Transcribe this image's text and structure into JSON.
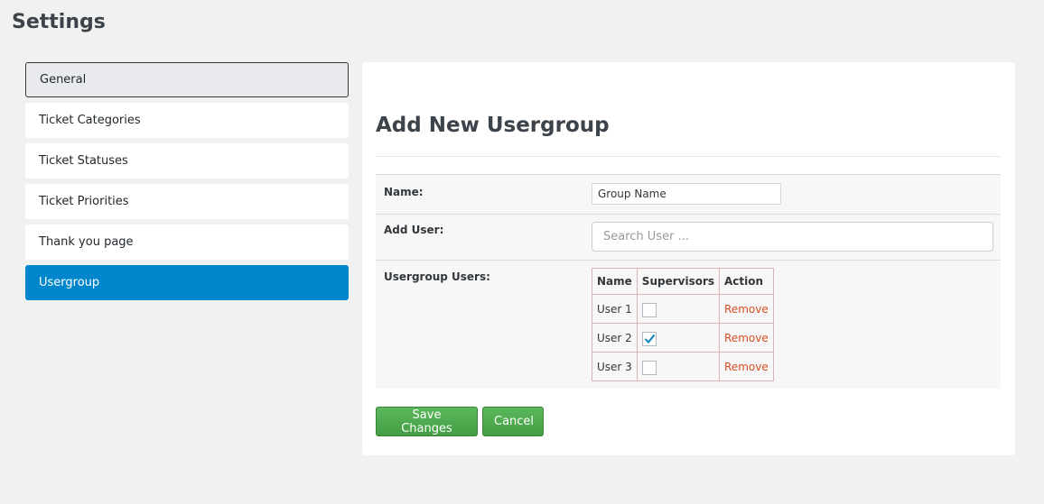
{
  "page": {
    "title": "Settings"
  },
  "sidebar": {
    "items": [
      {
        "label": "General"
      },
      {
        "label": "Ticket Categories"
      },
      {
        "label": "Ticket Statuses"
      },
      {
        "label": "Ticket Priorities"
      },
      {
        "label": "Thank you page"
      },
      {
        "label": "Usergroup"
      }
    ],
    "active_item": "Usergroup"
  },
  "panel": {
    "title": "Add New Usergroup",
    "name_label": "Name:",
    "name_value": "Group Name",
    "add_user_label": "Add User:",
    "search_placeholder": "Search User ...",
    "usergroup_users_label": "Usergroup Users:",
    "table": {
      "headers": [
        "Name",
        "Supervisors",
        "Action"
      ],
      "rows": [
        {
          "name": "User 1",
          "supervisor": false,
          "action": "Remove"
        },
        {
          "name": "User 2",
          "supervisor": true,
          "action": "Remove"
        },
        {
          "name": "User 3",
          "supervisor": false,
          "action": "Remove"
        }
      ]
    },
    "save_label": "Save Changes",
    "cancel_label": "Cancel"
  },
  "colors": {
    "accent": "#0086cc",
    "button_green": "#4cae4c",
    "remove_link": "#d54e21",
    "checkmark": "#1e8cbe"
  }
}
